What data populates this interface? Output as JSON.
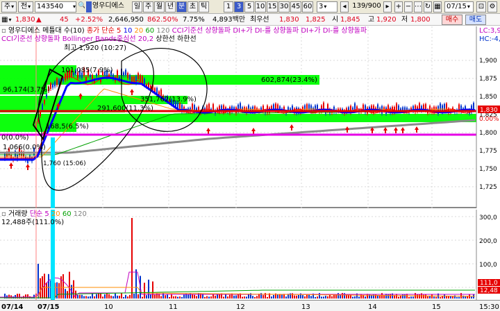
{
  "toolbar": {
    "type_label": "주",
    "box_label": "전",
    "code": "143540",
    "stock_name": "영우디에스",
    "periods": [
      "일",
      "주",
      "월",
      "년",
      "분",
      "초",
      "틱"
    ],
    "minutes": [
      "1",
      "3",
      "5",
      "10",
      "15",
      "30",
      "45",
      "60"
    ],
    "interval_value": "3",
    "page_count": "139/900",
    "date": "07/15"
  },
  "quote": {
    "price": "1,830",
    "change_arrow": "▲",
    "change": "45",
    "change_pct": "+2.52%",
    "volume": "2,646,950",
    "vol_pct": "862.50%",
    "turnover": "7.75%",
    "amount": "4,893백만",
    "best_label": "최우선",
    "ask": "1,830",
    "bid": "1,825",
    "open_label": "시",
    "open": "1,845",
    "high_label": "고",
    "high": "1,920",
    "low_label": "저",
    "low": "1,800",
    "buy_label": "매수",
    "sell_label": "매도"
  },
  "legend1": {
    "name": "영우디에스 메틀대 수(10)",
    "ma_label": "종가 단순",
    "ma_periods": [
      "5",
      "10",
      "20",
      "60",
      "120"
    ],
    "indicators": [
      "CCI기준선 상향돌파",
      "DI+가 DI-를 상향돌파",
      "DI+가 DI-를 상향돌파"
    ],
    "row2_a": "CCI기준선 상향돌파",
    "row2_b": "Bollinger Bands중심선 20,2",
    "row2_c": "상한선",
    "row2_d": "하한선",
    "right_lc": "LC:3,9",
    "right_hc": "HC:-4,"
  },
  "annotations": {
    "high_note": "최고 1,920 (10:27)",
    "low_note": "1,760 (15:06)",
    "zones": [
      "101,085(7.9%)",
      "96,174(3.7%)",
      "602,874(23.4%)",
      "351,762(13.9%)",
      "291,600(11.3%)",
      "168,5(6.5%)",
      "0(0.0%)",
      "1,066(0.0%)"
    ],
    "price_axis": [
      "1,900",
      "1,875",
      "1,850",
      "1,825",
      "1,800",
      "1,775",
      "1,750",
      "1,725"
    ],
    "price_tag": "1,830",
    "pct_tag": "0.00%"
  },
  "legend2": {
    "name": "거래량",
    "ma_label": "단순",
    "ma_periods": [
      "5",
      "20",
      "60",
      "120"
    ],
    "value": "12,488주(111.0%)",
    "axis": [
      "300,0",
      "200,0",
      "100,0"
    ],
    "tag_a": "111,0",
    "tag_b": "12,48"
  },
  "xaxis": {
    "labels": [
      "07/14",
      "07/15",
      "10",
      "11",
      "12",
      "13",
      "14",
      "15"
    ],
    "end_label": "15:30"
  },
  "colors": {
    "ma5": "#ff0000",
    "ma10": "#0000ff",
    "ma20": "#ff8c00",
    "ma60": "#00a000",
    "ma120": "#808080",
    "zone": "#00ff00",
    "support": "#e600e6",
    "cursor": "#00e5ff"
  }
}
